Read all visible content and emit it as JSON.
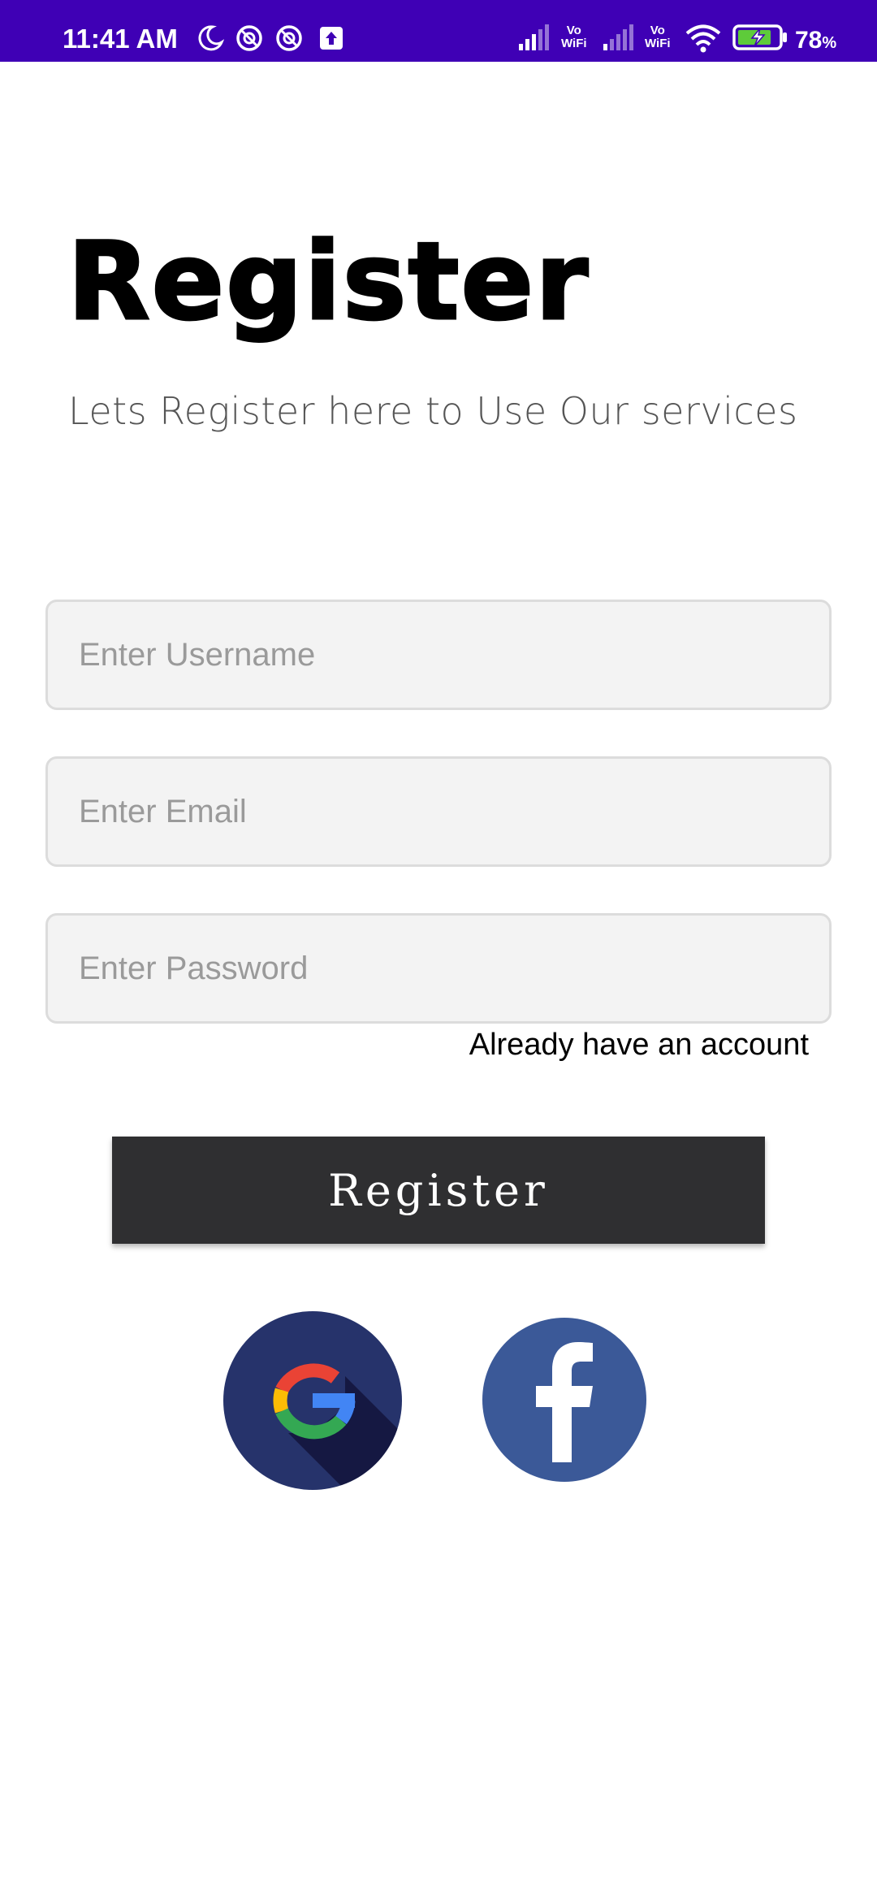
{
  "status_bar": {
    "time": "11:41 AM",
    "vo_label": "Vo",
    "wifi_label": "WiFi",
    "battery_percent": "78",
    "battery_percent_sign": "%",
    "background_color": "#3f00b5"
  },
  "header": {
    "title": "Register",
    "subtitle": "Lets Register here to Use Our services"
  },
  "form": {
    "username": {
      "placeholder": "Enter Username",
      "value": ""
    },
    "email": {
      "placeholder": "Enter Email",
      "value": ""
    },
    "password": {
      "placeholder": "Enter Password",
      "value": ""
    },
    "login_link": "Already have an account"
  },
  "actions": {
    "register_label": "Register",
    "register_color": "#2f2f31"
  },
  "social": {
    "google_icon": "google-icon",
    "facebook_icon": "facebook-icon",
    "google_bg": "#26336b",
    "facebook_bg": "#3b5998"
  }
}
